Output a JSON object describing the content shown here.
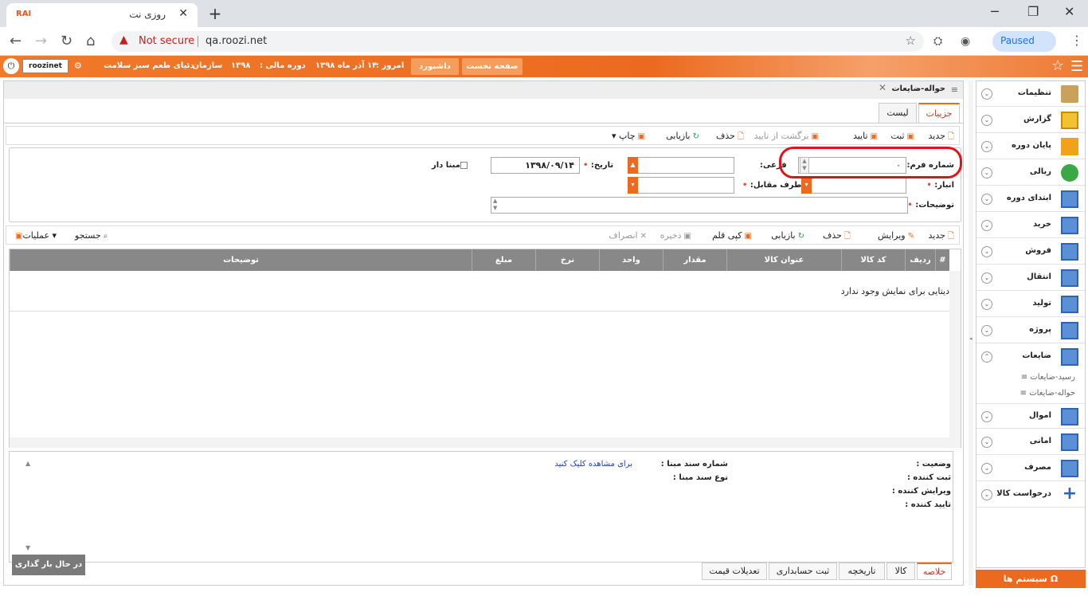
{
  "browser": {
    "tab_favicon": "RAI",
    "tab_title": "روزی نت",
    "tab_close": "✕",
    "new_tab": "+",
    "win_min": "─",
    "win_max": "❐",
    "win_close": "✕",
    "not_secure": "Not secure",
    "url": "qa.roozi.net",
    "paused": "Paused"
  },
  "appbar": {
    "user": "roozinet",
    "org_label": "سازمان :",
    "org_value": "دنیای طعم سبز سلامت",
    "period_label": "دوره مالی :",
    "period_value": "۱۳۹۸",
    "today_label": "امروز :",
    "today_value": "۱۴ آذر ماه ۱۳۹۸",
    "dashboard": "داشبورد",
    "home": "صفحه نخست"
  },
  "panel": {
    "title": "حواله-ضایعات",
    "tab_details": "جزییات",
    "tab_list": "لیست"
  },
  "toolbar": {
    "new": "جدید",
    "save": "ثبت",
    "confirm": "تایید",
    "unconfirm": "برگشت از تایید",
    "delete": "حذف",
    "refresh": "بازیابی",
    "print": "چاپ"
  },
  "form": {
    "form_no_label": "شماره فرم:",
    "form_no_value": "۰",
    "sub_label": "فرعی:",
    "date_label": "تاریخ:",
    "date_value": "۱۳۹۸/۰۹/۱۴",
    "has_base_label": "مبنا دار",
    "warehouse_label": "انبار:",
    "party_label": "طرف مقابل:",
    "desc_label": "توضیحات:"
  },
  "grid_toolbar": {
    "new": "جدید",
    "edit": "ویرایش",
    "delete": "حذف",
    "refresh": "بازیابی",
    "copy": "کپی قلم",
    "save": "ذخیره",
    "cancel": "انصراف",
    "search": "جستجو",
    "ops": "عملیات"
  },
  "grid": {
    "columns": [
      "#",
      "ردیف",
      "کد کالا",
      "عنوان کالا",
      "مقدار",
      "واحد",
      "نرخ",
      "مبلغ",
      "توضیحات"
    ],
    "empty": "دیتایی برای نمایش وجود ندارد"
  },
  "summary": {
    "status": "وضعیت :",
    "creator": "ثبت کننده :",
    "editor": "ویرایش کننده :",
    "approver": "تایید کننده :",
    "base_no": "شماره سند مبنا :",
    "base_type": "نوع سند مبنا :",
    "click_link": "برای مشاهده کلیک کنید"
  },
  "loading": "در حال بار گذاری ...",
  "bottom_tabs": [
    "خلاصه",
    "کالا",
    "تاریخچه",
    "ثبت حسابداری",
    "تعدیلات قیمت"
  ],
  "sidebar": {
    "items": [
      "تنظیمات",
      "گزارش",
      "پایان دوره",
      "ریالی",
      "ابتدای دوره",
      "خرید",
      "فروش",
      "انتقال",
      "تولید",
      "پروژه",
      "ضایعات",
      "اموال",
      "امانی",
      "مصرف",
      "درخواست کالا"
    ],
    "sub_items": [
      "رسید-ضایعات",
      "حواله-ضایعات"
    ],
    "system": "سیستم ها"
  }
}
